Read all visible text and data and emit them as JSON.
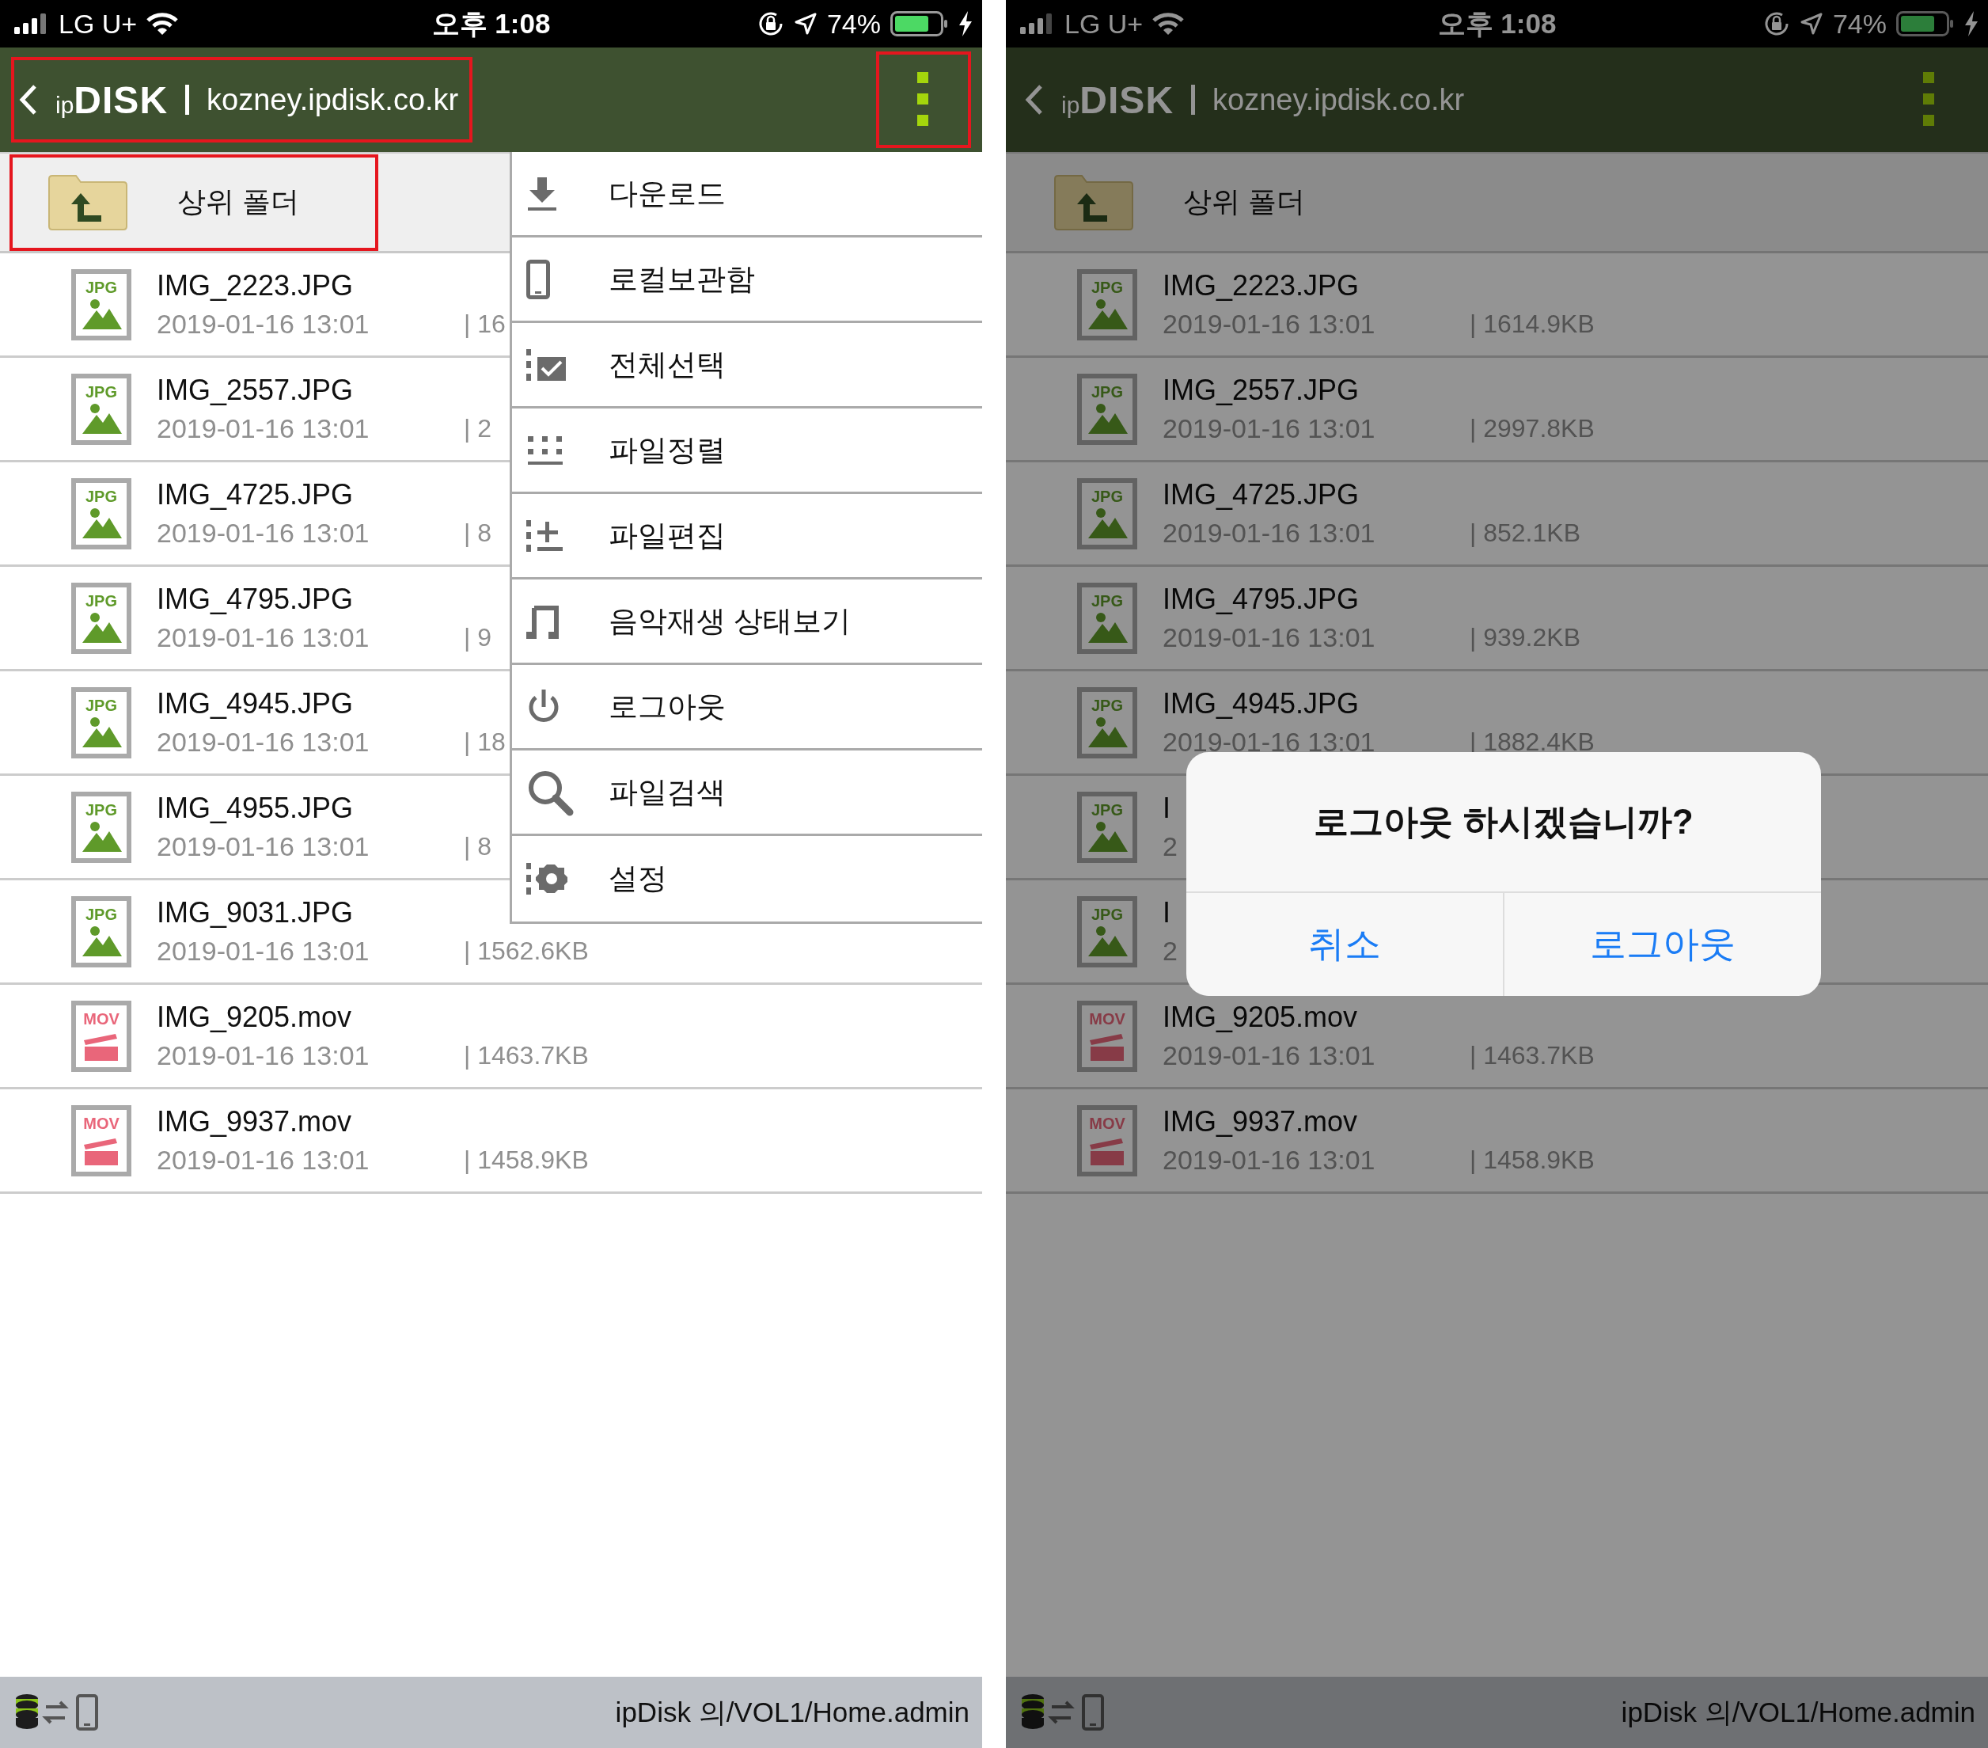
{
  "phones": [
    {
      "status_bar": {
        "carrier": "LG U+",
        "time": "오후 1:08",
        "battery": "74%"
      },
      "header": {
        "logo": "ip**DISK**",
        "host": "kozney.ipdisk.co.kr",
        "annotated": true,
        "menu_annotated": true
      },
      "parent_folder": {
        "label": "상위 폴더",
        "annotated": true
      },
      "files": [
        {
          "kind": "image",
          "type_label": "JPG",
          "name": "IMG_2223.JPG",
          "date": "2019-01-16 13:01",
          "size": "| 16"
        },
        {
          "kind": "image",
          "type_label": "JPG",
          "name": "IMG_2557.JPG",
          "date": "2019-01-16 13:01",
          "size": "| 2"
        },
        {
          "kind": "image",
          "type_label": "JPG",
          "name": "IMG_4725.JPG",
          "date": "2019-01-16 13:01",
          "size": "| 8"
        },
        {
          "kind": "image",
          "type_label": "JPG",
          "name": "IMG_4795.JPG",
          "date": "2019-01-16 13:01",
          "size": "| 9"
        },
        {
          "kind": "image",
          "type_label": "JPG",
          "name": "IMG_4945.JPG",
          "date": "2019-01-16 13:01",
          "size": "| 18"
        },
        {
          "kind": "image",
          "type_label": "JPG",
          "name": "IMG_4955.JPG",
          "date": "2019-01-16 13:01",
          "size": "| 8"
        },
        {
          "kind": "image",
          "type_label": "JPG",
          "name": "IMG_9031.JPG",
          "date": "2019-01-16 13:01",
          "size": "| 1562.6KB"
        },
        {
          "kind": "video",
          "type_label": "MOV",
          "name": "IMG_9205.mov",
          "date": "2019-01-16 13:01",
          "size": "| 1463.7KB"
        },
        {
          "kind": "video",
          "type_label": "MOV",
          "name": "IMG_9937.mov",
          "date": "2019-01-16 13:01",
          "size": "| 1458.9KB"
        }
      ],
      "menu": {
        "items": [
          {
            "kind": "download",
            "label": "다운로드"
          },
          {
            "kind": "phone",
            "label": "로컬보관함"
          },
          {
            "kind": "select",
            "label": "전체선택"
          },
          {
            "kind": "sort",
            "label": "파일정렬"
          },
          {
            "kind": "edit",
            "label": "파일편집"
          },
          {
            "kind": "music",
            "label": "음악재생 상태보기"
          },
          {
            "kind": "power",
            "label": "로그아웃"
          },
          {
            "kind": "search",
            "label": "파일검색"
          },
          {
            "kind": "settings",
            "label": "설정"
          }
        ]
      },
      "footer": {
        "path": "ipDisk 의/VOL1/Home.admin"
      }
    },
    {
      "status_bar": {
        "carrier": "LG U+",
        "time": "오후 1:08",
        "battery": "74%"
      },
      "header": {
        "logo": "ip**DISK**",
        "host": "kozney.ipdisk.co.kr",
        "annotated": false,
        "menu_annotated": false
      },
      "parent_folder": {
        "label": "상위 폴더",
        "annotated": false
      },
      "files": [
        {
          "kind": "image",
          "type_label": "JPG",
          "name": "IMG_2223.JPG",
          "date": "2019-01-16 13:01",
          "size": "| 1614.9KB"
        },
        {
          "kind": "image",
          "type_label": "JPG",
          "name": "IMG_2557.JPG",
          "date": "2019-01-16 13:01",
          "size": "| 2997.8KB"
        },
        {
          "kind": "image",
          "type_label": "JPG",
          "name": "IMG_4725.JPG",
          "date": "2019-01-16 13:01",
          "size": "| 852.1KB"
        },
        {
          "kind": "image",
          "type_label": "JPG",
          "name": "IMG_4795.JPG",
          "date": "2019-01-16 13:01",
          "size": "| 939.2KB"
        },
        {
          "kind": "image",
          "type_label": "JPG",
          "name": "IMG_4945.JPG",
          "date": "2019-01-16 13:01",
          "size": "| 1882.4KB"
        },
        {
          "kind": "image",
          "type_label": "JPG",
          "name": "I",
          "date": "2"
        },
        {
          "kind": "image",
          "type_label": "JPG",
          "name": "I",
          "date": "2"
        },
        {
          "kind": "video",
          "type_label": "MOV",
          "name": "IMG_9205.mov",
          "date": "2019-01-16 13:01",
          "size": "| 1463.7KB"
        },
        {
          "kind": "video",
          "type_label": "MOV",
          "name": "IMG_9937.mov",
          "date": "2019-01-16 13:01",
          "size": "| 1458.9KB"
        }
      ],
      "footer": {
        "path": "ipDisk 의/VOL1/Home.admin"
      },
      "dialog": {
        "title": "로그아웃 하시겠습니까?",
        "buttons": [
          "취소",
          "로그아웃"
        ]
      }
    }
  ]
}
